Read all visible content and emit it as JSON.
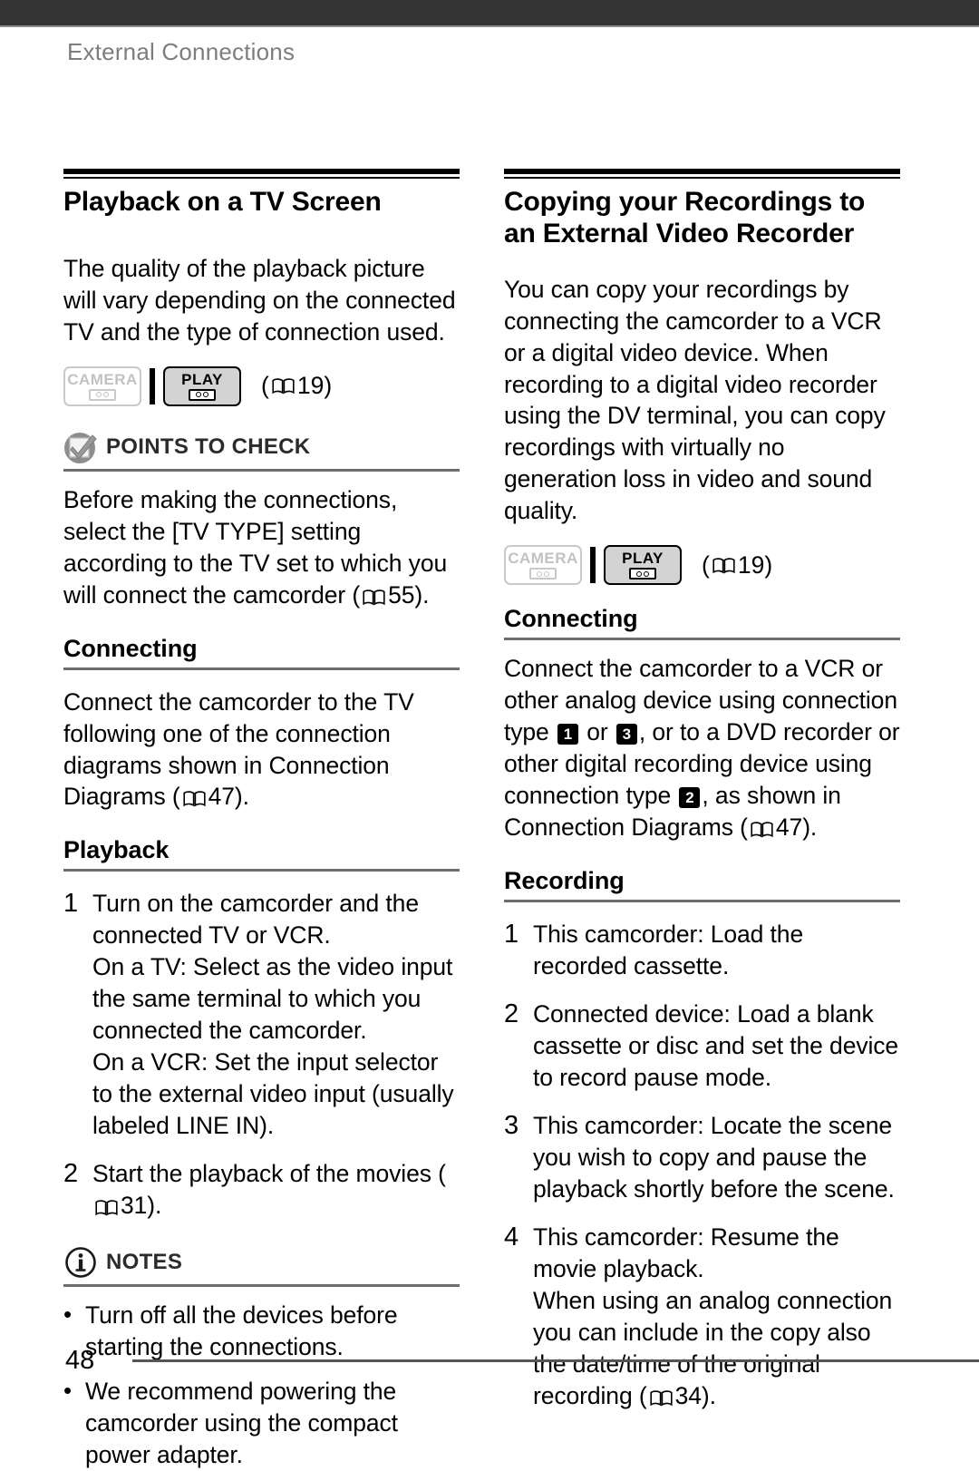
{
  "header": {
    "running_title": "External Connections"
  },
  "left_column": {
    "section_title": "Playback on a TV Screen",
    "intro": "The quality of the playback picture will vary depending on the connected TV and the type of connection used.",
    "mode_badges": {
      "camera_label": "CAMERA",
      "camera_state": "inactive",
      "play_label": "PLAY",
      "play_state": "active",
      "page_ref_open": "(",
      "page_ref_number": "19",
      "page_ref_close": ")"
    },
    "points_to_check": {
      "title": "POINTS TO CHECK",
      "icon": "checkbox-pencil-icon",
      "text_before_ref": "Before making the connections, select the [TV TYPE] setting according to the TV set to which you will connect the camcorder (",
      "ref_number": "55",
      "text_after_ref": ")."
    },
    "connecting": {
      "title": "Connecting",
      "text_before_ref": "Connect the camcorder to the TV following one of the connection diagrams shown in Connection Diagrams (",
      "ref_number": "47",
      "text_after_ref": ")."
    },
    "playback": {
      "title": "Playback",
      "steps": [
        {
          "number": "1",
          "lines": [
            "Turn on the camcorder and the connected TV or VCR.",
            "On a TV: Select as the video input the same terminal to which you connected the camcorder.",
            "On a VCR: Set the input selector to the external video input (usually labeled LINE IN)."
          ]
        },
        {
          "number": "2",
          "text_before_ref": "Start the playback of the movies (",
          "ref_number": "31",
          "text_after_ref": ")."
        }
      ]
    },
    "notes": {
      "title": "NOTES",
      "icon": "info-circle-icon",
      "bullet_marker": "•",
      "items": [
        "Turn off all the devices before starting the connections.",
        "We recommend powering the camcorder using the compact power adapter."
      ]
    }
  },
  "right_column": {
    "section_title": "Copying your Recordings to an External Video Recorder",
    "intro": "You can copy your recordings by connecting the camcorder to a VCR or a digital video device. When recording to a digital video recorder using the DV terminal, you can copy recordings with virtually no generation loss in video and sound quality.",
    "mode_badges": {
      "camera_label": "CAMERA",
      "camera_state": "inactive",
      "play_label": "PLAY",
      "play_state": "active",
      "page_ref_open": "(",
      "page_ref_number": "19",
      "page_ref_close": ")"
    },
    "connecting": {
      "title": "Connecting",
      "part1": "Connect the camcorder to a VCR or other analog device using connection type ",
      "chip1": "1",
      "part2": " or ",
      "chip2": "3",
      "part3": ", or to a DVD recorder or other digital recording device using connection type ",
      "chip3": "2",
      "part4": ", as shown in Connection Diagrams (",
      "ref_number": "47",
      "part5": ")."
    },
    "recording": {
      "title": "Recording",
      "steps": [
        {
          "number": "1",
          "lines": [
            "This camcorder: Load the recorded cassette."
          ]
        },
        {
          "number": "2",
          "lines": [
            "Connected device: Load a blank cassette or disc and set the device to record pause mode."
          ]
        },
        {
          "number": "3",
          "lines": [
            "This camcorder: Locate the scene you wish to copy and pause the playback shortly before the scene."
          ]
        },
        {
          "number": "4",
          "lines": [
            "This camcorder: Resume the movie playback."
          ],
          "note_before_ref": "When using an analog connection you can include in the copy also the date/time of the original recording (",
          "note_ref_number": "34",
          "note_after_ref": ")."
        }
      ]
    }
  },
  "footer": {
    "page_number": "48"
  },
  "colors": {
    "topbar": "#333333",
    "running_header_text": "#7d7d7d",
    "rule_grey": "#6e6e6e",
    "badge_active_bg": "#d3d3d3",
    "badge_inactive_border": "#c9c9c9",
    "chip_bg": "#000000"
  }
}
